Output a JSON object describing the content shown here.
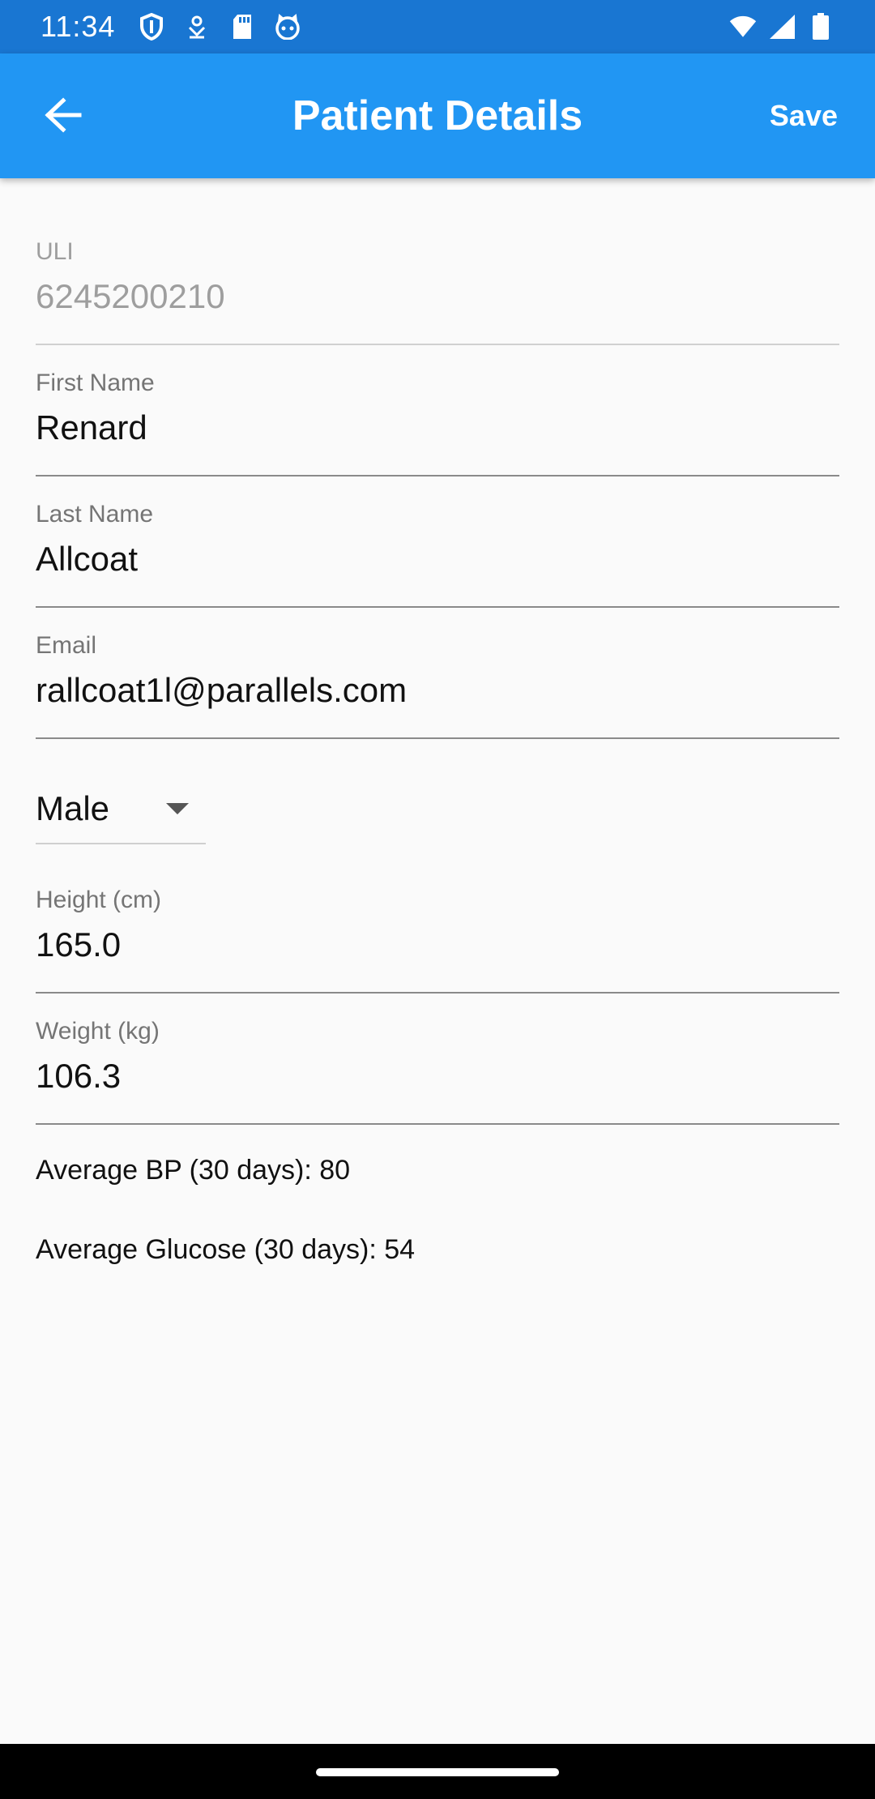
{
  "status_bar": {
    "time": "11:34",
    "icons_left": [
      "shield-icon",
      "download-icon",
      "sd-card-icon",
      "cat-face-icon"
    ],
    "icons_right": [
      "wifi-icon",
      "cell-signal-icon",
      "battery-icon"
    ]
  },
  "app_bar": {
    "title": "Patient Details",
    "save_label": "Save",
    "back_icon": "arrow-left-icon",
    "color": "#2196f3",
    "status_color": "#1976d2"
  },
  "form": {
    "uli": {
      "label": "ULI",
      "value": "6245200210"
    },
    "first_name": {
      "label": "First Name",
      "value": "Renard"
    },
    "last_name": {
      "label": "Last Name",
      "value": "Allcoat"
    },
    "email": {
      "label": "Email",
      "value": "rallcoat1l@parallels.com"
    },
    "gender": {
      "value": "Male"
    },
    "height": {
      "label": "Height (cm)",
      "value": "165.0"
    },
    "weight": {
      "label": "Weight (kg)",
      "value": "106.3"
    }
  },
  "stats": {
    "avg_bp": "Average BP (30 days): 80",
    "avg_glucose": "Average Glucose (30 days): 54"
  }
}
